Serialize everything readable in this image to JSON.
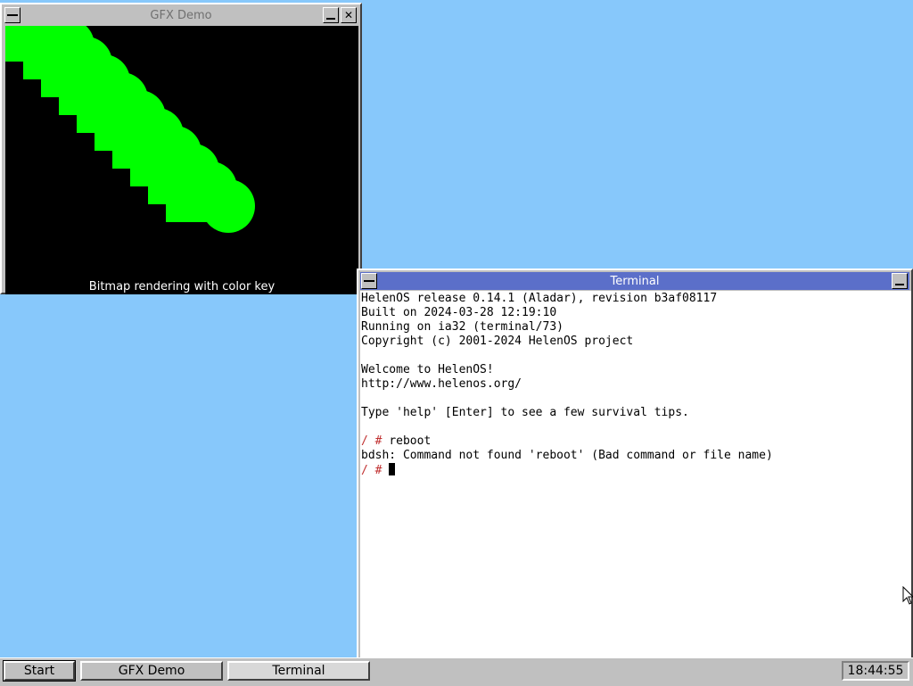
{
  "colors": {
    "desktop": "#87c8fb",
    "active_title": "#5b6fc9",
    "shape_green": "#00ff00",
    "prompt_red": "#c03030"
  },
  "gfx_window": {
    "title": "GFX Demo",
    "caption": "Bitmap rendering with color key"
  },
  "terminal": {
    "title": "Terminal",
    "lines": [
      "HelenOS release 0.14.1 (Aladar), revision b3af08117",
      "Built on 2024-03-28 12:19:10",
      "Running on ia32 (terminal/73)",
      "Copyright (c) 2001-2024 HelenOS project",
      "",
      "Welcome to HelenOS!",
      "http://www.helenos.org/",
      "",
      "Type 'help' [Enter] to see a few survival tips.",
      ""
    ],
    "prompt": "/ #",
    "command": "reboot",
    "error_line": "bdsh: Command not found 'reboot' (Bad command or file name)"
  },
  "taskbar": {
    "start_label": "Start",
    "tasks": [
      "GFX Demo",
      "Terminal"
    ],
    "clock": "18:44:55"
  },
  "icons": [
    "system-menu-icon",
    "minimize-icon",
    "close-icon",
    "mouse-pointer-icon"
  ]
}
